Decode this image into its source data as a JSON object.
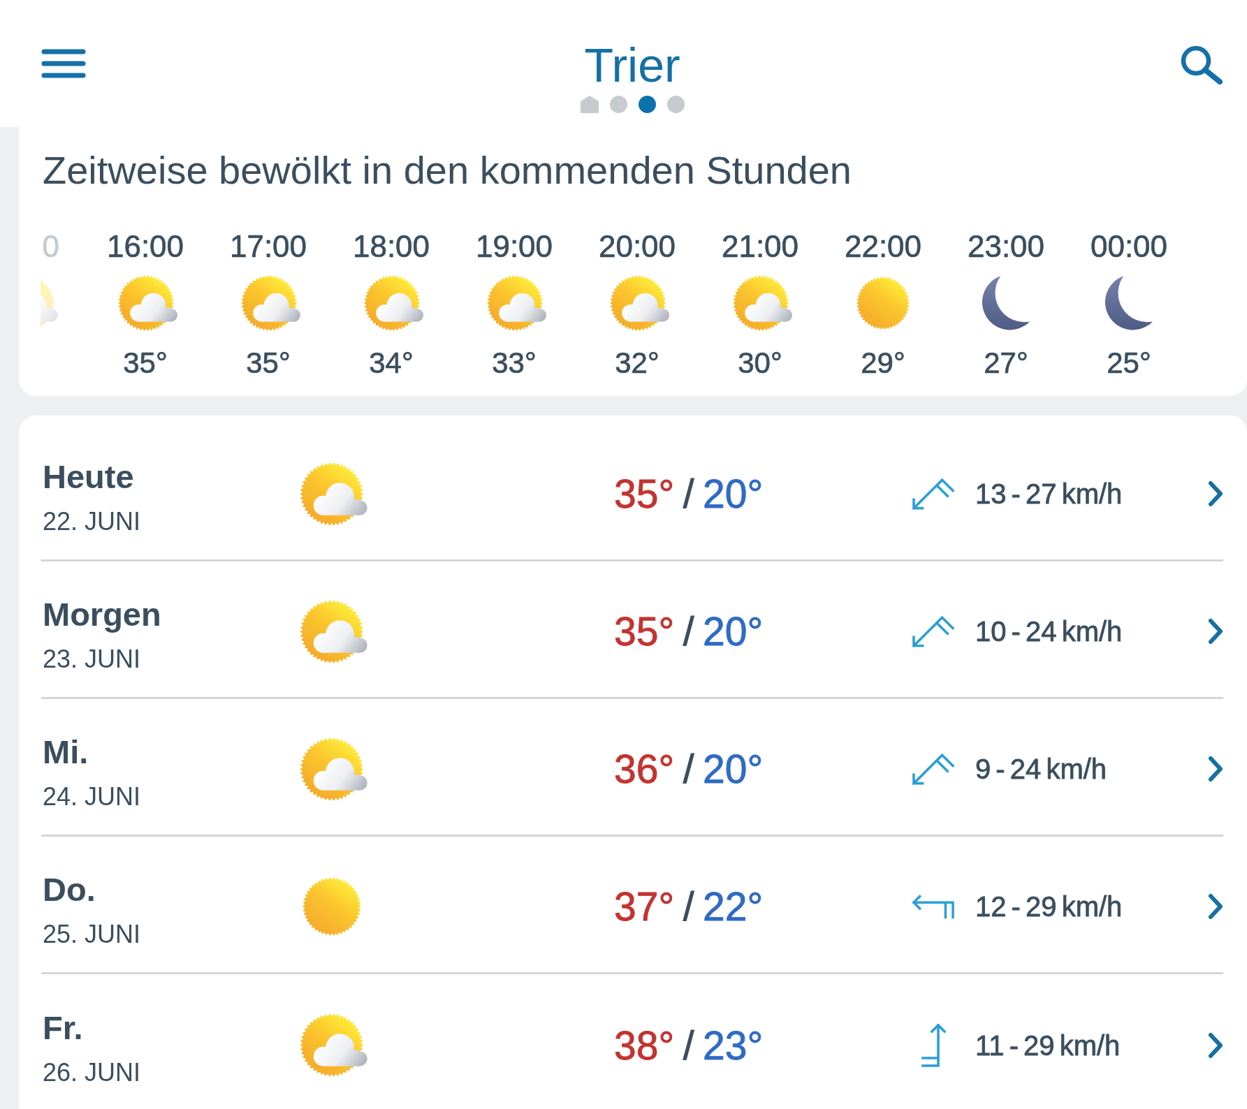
{
  "header": {
    "title": "Trier",
    "pages": [
      {
        "kind": "home",
        "selected": false
      },
      {
        "kind": "dot",
        "selected": false
      },
      {
        "kind": "dot",
        "selected": true
      },
      {
        "kind": "dot",
        "selected": false
      }
    ]
  },
  "hourly": {
    "summary": "Zeitweise bewölkt in den kommenden Stunden",
    "hours": [
      {
        "time": "0",
        "kind": "partly-cloudy",
        "partial": true
      },
      {
        "time": "16:00",
        "kind": "partly-cloudy",
        "temp": "35°",
        "partial": false
      },
      {
        "time": "17:00",
        "kind": "partly-cloudy",
        "temp": "35°",
        "partial": false
      },
      {
        "time": "18:00",
        "kind": "partly-cloudy",
        "temp": "34°",
        "partial": false
      },
      {
        "time": "19:00",
        "kind": "partly-cloudy",
        "temp": "33°",
        "partial": false
      },
      {
        "time": "20:00",
        "kind": "partly-cloudy",
        "temp": "32°",
        "partial": false
      },
      {
        "time": "21:00",
        "kind": "partly-cloudy",
        "temp": "30°",
        "partial": false
      },
      {
        "time": "22:00",
        "kind": "sunny",
        "temp": "29°",
        "partial": false
      },
      {
        "time": "23:00",
        "kind": "night",
        "temp": "27°",
        "partial": false
      },
      {
        "time": "00:00",
        "kind": "night",
        "temp": "25°",
        "partial": false
      }
    ]
  },
  "days": [
    {
      "name": "Heute",
      "date": "22. JUNI",
      "kind": "partly-cloudy",
      "high": "35°",
      "separator": "/",
      "low": "20°",
      "wind": {
        "kind": "northeast",
        "speed": "13 - 27 km/h"
      }
    },
    {
      "name": "Morgen",
      "date": "23. JUNI",
      "kind": "partly-cloudy",
      "high": "35°",
      "separator": "/",
      "low": "20°",
      "wind": {
        "kind": "northeast",
        "speed": "10 - 24 km/h"
      }
    },
    {
      "name": "Mi.",
      "date": "24. JUNI",
      "kind": "partly-cloudy",
      "high": "36°",
      "separator": "/",
      "low": "20°",
      "wind": {
        "kind": "northeast",
        "speed": "9 - 24 km/h"
      }
    },
    {
      "name": "Do.",
      "date": "25. JUNI",
      "kind": "sunny",
      "high": "37°",
      "separator": "/",
      "low": "22°",
      "wind": {
        "kind": "east",
        "speed": "12 - 29 km/h"
      }
    },
    {
      "name": "Fr.",
      "date": "26. JUNI",
      "kind": "partly-cloudy",
      "high": "38°",
      "separator": "/",
      "low": "23°",
      "wind": {
        "kind": "south",
        "speed": "11 - 29 km/h"
      }
    }
  ]
}
